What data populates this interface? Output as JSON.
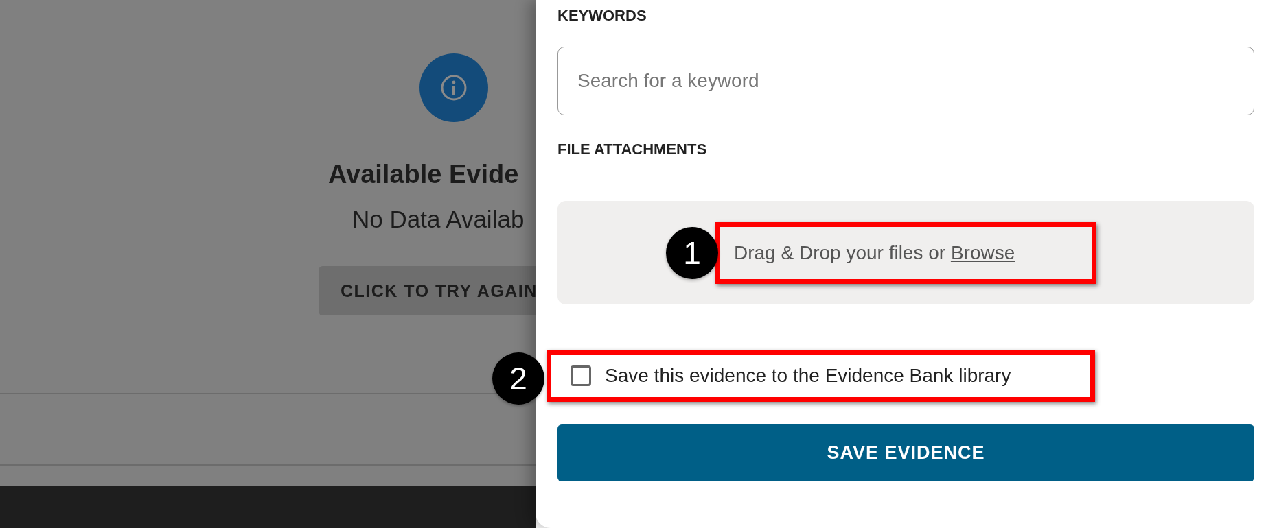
{
  "background_page": {
    "title": "Available Evide",
    "message": "No Data Availab",
    "retry_button": "CLICK TO TRY AGAIN"
  },
  "panel": {
    "keywords": {
      "label": "KEYWORDS",
      "placeholder": "Search for a keyword"
    },
    "attachments": {
      "label": "FILE ATTACHMENTS",
      "prompt": "Drag & Drop your files or",
      "link": "Browse"
    },
    "save_to_library": {
      "label": "Save this evidence to the Evidence Bank library",
      "checked": false
    },
    "save_button": "SAVE EVIDENCE"
  },
  "annotations": [
    {
      "number": "1"
    },
    {
      "number": "2"
    }
  ]
}
